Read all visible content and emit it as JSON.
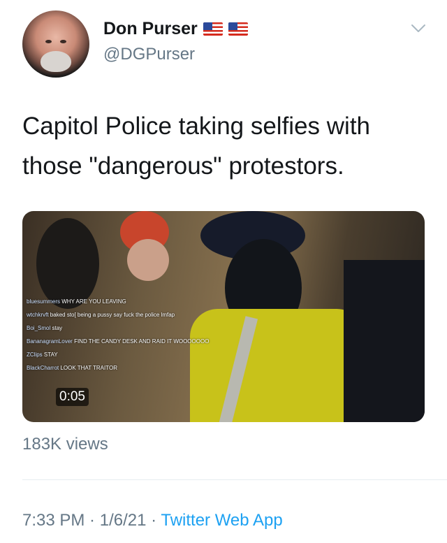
{
  "author": {
    "name": "Don Purser",
    "handle": "@DGPurser",
    "badges": [
      "us-flag-icon",
      "us-flag-icon"
    ]
  },
  "tweet": {
    "text": "Capitol Police taking selfies with those \"dangerous\" protestors."
  },
  "media": {
    "timer": "0:05",
    "chat": [
      {
        "user": "bluesummers",
        "text": "WHY ARE YOU LEAVING"
      },
      {
        "user": "wtchkrvft",
        "text": "baked sto[ being a pussy say fuck the police lmfap"
      },
      {
        "user": "Boi_Smol",
        "text": "stay"
      },
      {
        "user": "BananagramLover",
        "text": "FIND THE CANDY DESK AND RAID IT WOOOOOOO"
      },
      {
        "user": "ZClips",
        "text": "STAY"
      },
      {
        "user": "BlackCharrot",
        "text": "LOOK THAT TRAITOR"
      }
    ]
  },
  "stats": {
    "views": "183K views"
  },
  "meta": {
    "time": "7:33 PM",
    "separator": " · ",
    "date": "1/6/21",
    "app": "Twitter Web App"
  },
  "colors": {
    "link": "#1da1f2",
    "secondary_text": "#657786"
  }
}
